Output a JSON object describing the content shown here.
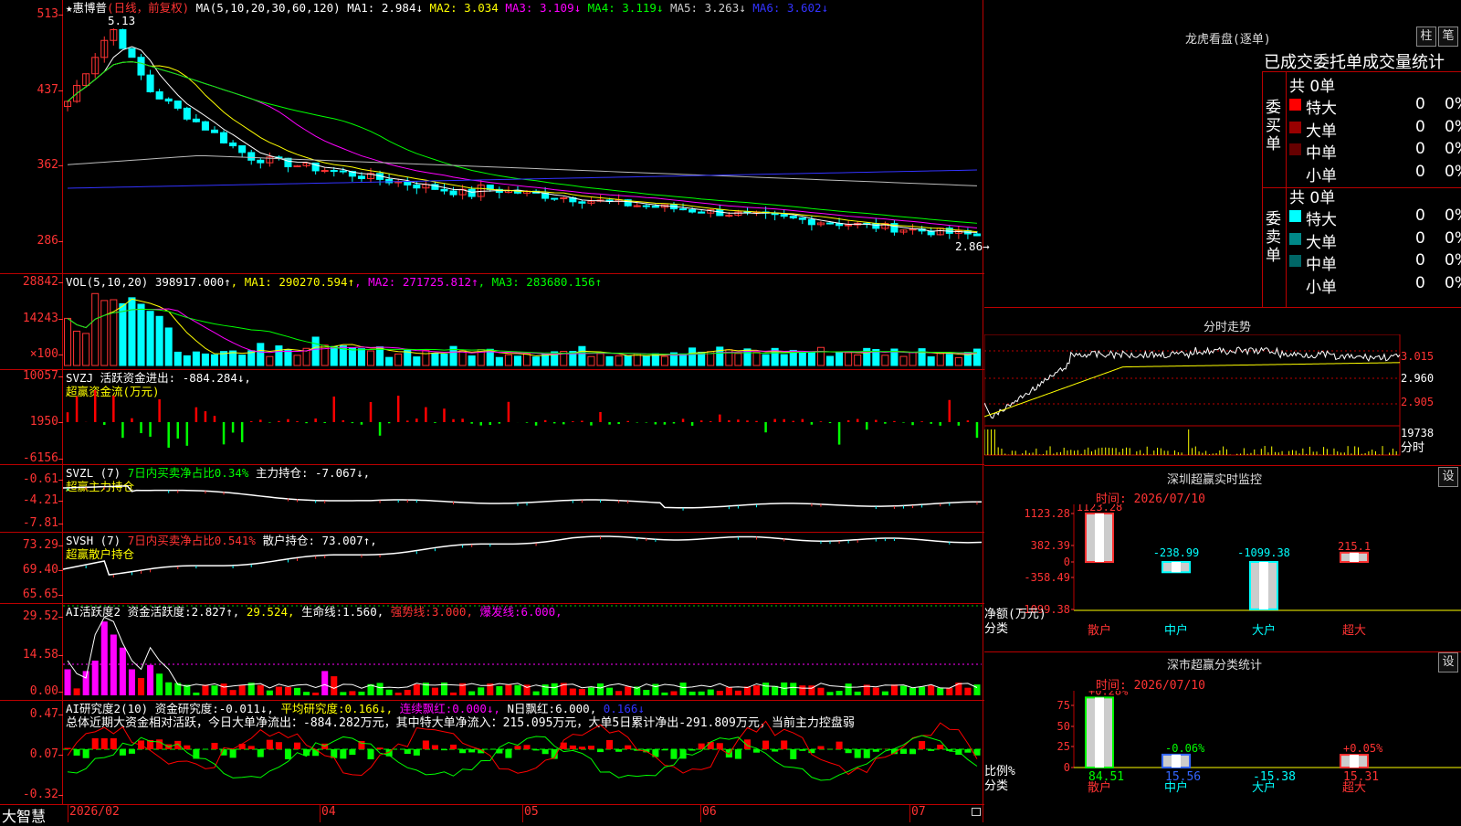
{
  "stock": {
    "name": "惠博普",
    "period": "(日线，前复权)",
    "star": "★"
  },
  "main": {
    "ma_label": "MA(5,10,20,30,60,120)",
    "ma": [
      {
        "k": "MA1:",
        "v": "2.984↓",
        "c": "#fff"
      },
      {
        "k": "MA2:",
        "v": "3.034",
        "c": "#ff0"
      },
      {
        "k": "MA3:",
        "v": "3.109↓",
        "c": "#f0f"
      },
      {
        "k": "MA4:",
        "v": "3.119↓",
        "c": "#0f0"
      },
      {
        "k": "MA5:",
        "v": "3.263↓",
        "c": "#ccc"
      },
      {
        "k": "MA6:",
        "v": "3.602↓",
        "c": "#33f"
      }
    ],
    "y_ticks": [
      "513",
      "437",
      "362",
      "286"
    ],
    "high_label": "5.13",
    "last_label": "2.86→"
  },
  "vol": {
    "label": "VOL(5,10,20)",
    "v": "398917.000↑",
    "ma": [
      {
        "k": "MA1:",
        "v": "290270.594↑",
        "c": "#ff0"
      },
      {
        "k": "MA2:",
        "v": "271725.812↑",
        "c": "#f0f"
      },
      {
        "k": "MA3:",
        "v": "283680.156↑",
        "c": "#0f0"
      }
    ],
    "y_ticks": [
      "28842",
      "14243",
      "×100"
    ]
  },
  "svzj": {
    "label": "SVZJ",
    "t1": "活跃资金进出:",
    "v1": "-884.284↓,",
    "t2": "超赢资金流(万元)",
    "y_ticks": [
      "10057",
      "1950",
      "-6156"
    ]
  },
  "svzl": {
    "label": "SVZL (7)",
    "t1": "7日内买卖净占比0.34%",
    "t2": "主力持仓:",
    "v2": "-7.067↓,",
    "t3": "超赢主力持仓",
    "y_ticks": [
      "-0.61",
      "-4.21",
      "-7.81"
    ]
  },
  "svsh": {
    "label": "SVSH (7)",
    "t1": "7日内买卖净占比0.541%",
    "t2": "散户持仓:",
    "v2": "73.007↑,",
    "t3": "超赢散户持仓",
    "y_ticks": [
      "73.29",
      "69.40",
      "65.65"
    ]
  },
  "ai1": {
    "label": "AI活跃度2",
    "t1": "资金活跃度:",
    "v1": "2.827↑,",
    "v2": "29.524,",
    "t3": "生命线:",
    "v3": "1.560,",
    "t4": "强势线:",
    "v4": "3.000,",
    "t5": "爆发线:",
    "v5": "6.000,",
    "y_ticks": [
      "29.52",
      "14.58",
      "0.00"
    ]
  },
  "ai2": {
    "label": "AI研究度2(10)",
    "t1": "资金研究度:",
    "v1": "-0.011↓,",
    "t2": "平均研究度:",
    "v2": "0.166↓,",
    "t3": "连续飘红:",
    "v3": "0.000↓,",
    "t4": "N日飘红:",
    "v4": "6.000,",
    "v5": "0.166↓",
    "summary": "总体近期大资金相对活跃，今日大单净流出：-884.282万元，其中特大单净流入：215.095万元，大单5日累计净出-291.809万元，当前主力控盘弱",
    "y_ticks": [
      "0.47",
      "0.07",
      "-0.32"
    ]
  },
  "x_axis": {
    "brand": "大智慧",
    "labels": [
      "2026/02",
      "04",
      "05",
      "06",
      "07"
    ]
  },
  "lhb": {
    "title": "龙虎看盘(逐单)",
    "btn1": "柱",
    "btn2": "笔",
    "subtitle": "已成交委托单成交量统计",
    "buy": {
      "side": "委买单",
      "total": "共 0单",
      "rows": [
        {
          "n": "特大",
          "v": "0",
          "p": "0%",
          "c": "#f00"
        },
        {
          "n": "大单",
          "v": "0",
          "p": "0%",
          "c": "#900"
        },
        {
          "n": "中单",
          "v": "0",
          "p": "0%",
          "c": "#600"
        },
        {
          "n": "小单",
          "v": "0",
          "p": "0%",
          "c": ""
        }
      ]
    },
    "sell": {
      "side": "委卖单",
      "total": "共 0单",
      "rows": [
        {
          "n": "特大",
          "v": "0",
          "p": "0%",
          "c": "#0ff"
        },
        {
          "n": "大单",
          "v": "0",
          "p": "0%",
          "c": "#088"
        },
        {
          "n": "中单",
          "v": "0",
          "p": "0%",
          "c": "#066"
        },
        {
          "n": "小单",
          "v": "0",
          "p": "0%",
          "c": ""
        }
      ]
    }
  },
  "fenshi": {
    "title": "分时走势",
    "y_ticks": [
      "3.015",
      "2.960",
      "2.905"
    ],
    "vol_label": "19738",
    "unit": "分时"
  },
  "monitor": {
    "title": "深圳超赢实时监控",
    "btn": "设",
    "time": "时间: 2026/07/10",
    "y_ticks": [
      "1123.28",
      "382.39",
      "0",
      "-358.49",
      "-1099.38"
    ],
    "yl1": "净额(万元)",
    "yl2": "分类",
    "cats": [
      "散户",
      "中户",
      "大户",
      "超大"
    ],
    "bars": [
      {
        "value": 1123.28,
        "label": "1123.28"
      },
      {
        "value": -238.99,
        "label": "-238.99"
      },
      {
        "value": -1099.38,
        "label": "-1099.38"
      },
      {
        "value": 215.1,
        "label": "215.1"
      }
    ]
  },
  "classify": {
    "title": "深市超赢分类统计",
    "btn": "设",
    "time": "时间: 2026/07/10",
    "y_ticks": [
      "75",
      "50",
      "25",
      "0"
    ],
    "yl1": "比例%",
    "yl2": "分类",
    "cats": [
      "散户",
      "中户",
      "大户",
      "超大"
    ],
    "bars": [
      {
        "value": 84.51,
        "top": "+0.28%",
        "bottom": "84.51"
      },
      {
        "value": 15.56,
        "top": "-0.06%",
        "bottom": "15.56"
      },
      {
        "value": 0,
        "top": "",
        "bottom": "-15.38"
      },
      {
        "value": 15.31,
        "top": "+0.05%",
        "bottom": "15.31"
      }
    ]
  },
  "chart_data": {
    "type": "candlestick",
    "y_range": [
      2.86,
      5.13
    ],
    "note_values": "ranges only"
  }
}
